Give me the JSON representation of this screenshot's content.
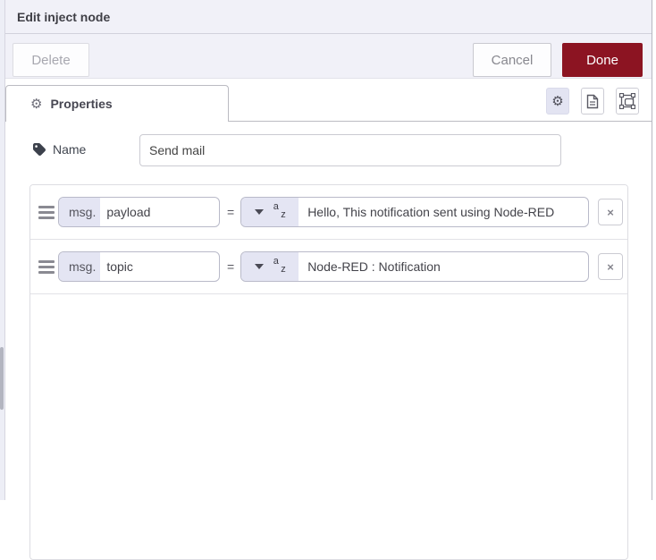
{
  "window": {
    "title": "Edit inject node"
  },
  "toolbar": {
    "delete_label": "Delete",
    "cancel_label": "Cancel",
    "done_label": "Done"
  },
  "tabs": {
    "properties_label": "Properties",
    "icon_buttons": [
      "properties-gear",
      "description-document",
      "appearance-frame"
    ]
  },
  "form": {
    "name_label": "Name",
    "name_value": "Send mail"
  },
  "rules": {
    "equals": "=",
    "type_letters": {
      "top": "a",
      "bottom": "z"
    },
    "remove_glyph": "×",
    "rows": [
      {
        "prefix": "msg.",
        "property": "payload",
        "value": "Hello, This notification sent using Node-RED"
      },
      {
        "prefix": "msg.",
        "property": "topic",
        "value": "Node-RED : Notification"
      }
    ]
  },
  "icons": {
    "gear": "⚙"
  },
  "colors": {
    "accent_red": "#8C1422",
    "panel_bg": "#f1f1f8",
    "typed_input_prefix_bg": "#e4e5f3",
    "border": "#bbbbc2"
  }
}
